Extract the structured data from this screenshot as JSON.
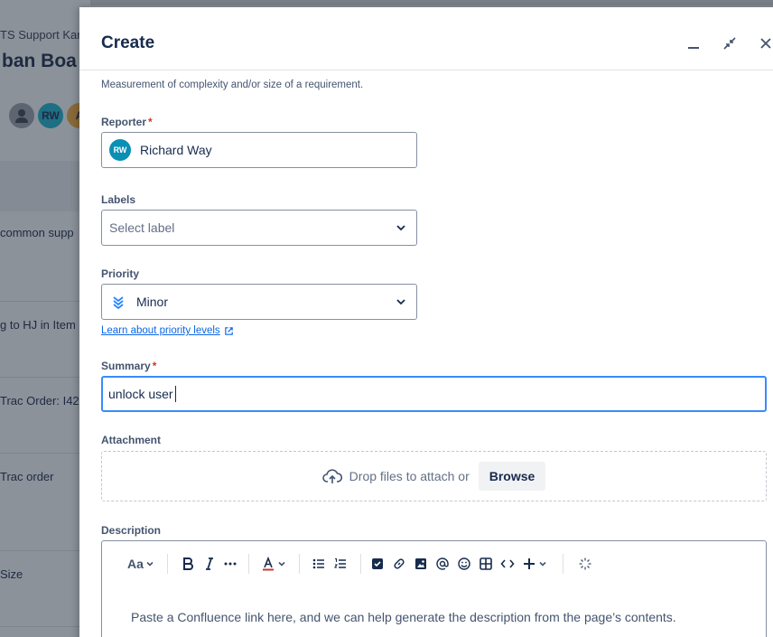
{
  "background": {
    "breadcrumb": "TS Support Kan",
    "board_title": "ban Boa",
    "avatars": [
      "",
      "RW",
      "A"
    ],
    "cards": [
      "common supp",
      "g to HJ in Item",
      "Trac Order: I42",
      "Trac order",
      "Size"
    ]
  },
  "modal": {
    "title": "Create",
    "helper_text": "Measurement of complexity and/or size of a requirement.",
    "reporter": {
      "label": "Reporter",
      "required": "*",
      "avatar_initials": "RW",
      "value": "Richard Way"
    },
    "labels": {
      "label": "Labels",
      "placeholder": "Select label"
    },
    "priority": {
      "label": "Priority",
      "value": "Minor",
      "link": "Learn about priority levels"
    },
    "summary": {
      "label": "Summary",
      "required": "*",
      "value": "unlock user"
    },
    "attachment": {
      "label": "Attachment",
      "drop_text": "Drop files to attach or",
      "browse": "Browse"
    },
    "description": {
      "label": "Description",
      "text_style": "Aa",
      "placeholder": "Paste a Confluence link here, and we can help generate the description from the page’s contents."
    }
  },
  "colors": {
    "accent": "#0c66e4",
    "focus": "#388bff",
    "required": "#c9372c"
  }
}
